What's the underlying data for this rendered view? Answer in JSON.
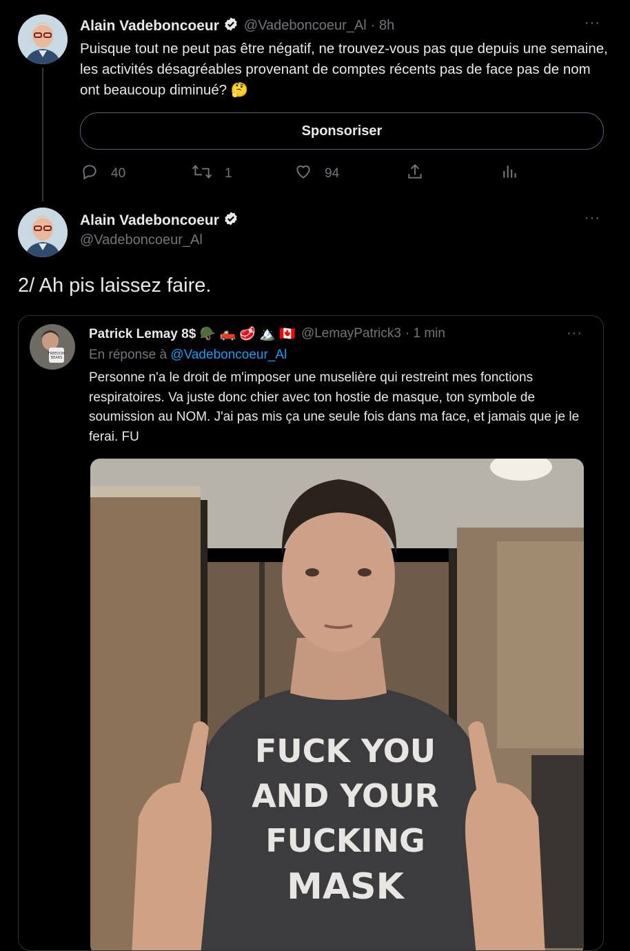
{
  "tweet1": {
    "author_name": "Alain Vadeboncoeur",
    "handle": "@Vadeboncoeur_Al",
    "time": "· 8h",
    "more": "···",
    "text": "Puisque tout ne peut pas être négatif, ne trouvez-vous pas que depuis une semaine, les activités désagréables provenant de comptes récents pas de face pas de nom ont beaucoup diminué? 🤔",
    "sponsor_label": "Sponsoriser",
    "actions": {
      "replies": "40",
      "retweets": "1",
      "likes": "94"
    }
  },
  "tweet2": {
    "author_name": "Alain Vadeboncoeur",
    "handle": "@Vadeboncoeur_Al",
    "more": "···",
    "text": "2/ Ah pis laissez faire."
  },
  "quote": {
    "author_name": "Patrick Lemay 8$ 🪖 🛻 🥩 🏔️ 🇨🇦",
    "handle": "@LemayPatrick3",
    "time": "· 1 min",
    "more": "···",
    "reply_prefix": "En réponse à",
    "reply_to": "@Vadeboncoeur_Al",
    "text": "Personne n'a le droit de m'imposer une muselière qui restreint mes fonctions respiratoires. Va juste donc chier avec ton hostie de masque, ton symbole de soumission au NOM. J'ai pas mis ça une seule fois dans ma face, et jamais que je le ferai. FU",
    "shirt_text": [
      "FUCK YOU",
      "AND YOUR",
      "FUCKING",
      "MASK"
    ],
    "mug_text": [
      "FREEDOM",
      "BEARS"
    ]
  },
  "colors": {
    "background": "#000000",
    "accent": "#1d9bf0",
    "muted": "#71767b",
    "verified": "#e7e9ea"
  }
}
